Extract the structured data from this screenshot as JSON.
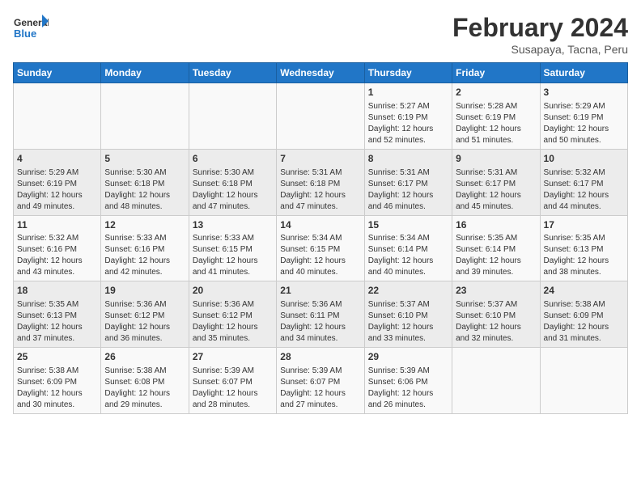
{
  "header": {
    "logo_line1": "General",
    "logo_line2": "Blue",
    "month_title": "February 2024",
    "subtitle": "Susapaya, Tacna, Peru"
  },
  "days_of_week": [
    "Sunday",
    "Monday",
    "Tuesday",
    "Wednesday",
    "Thursday",
    "Friday",
    "Saturday"
  ],
  "weeks": [
    [
      {
        "day": "",
        "info": ""
      },
      {
        "day": "",
        "info": ""
      },
      {
        "day": "",
        "info": ""
      },
      {
        "day": "",
        "info": ""
      },
      {
        "day": "1",
        "info": "Sunrise: 5:27 AM\nSunset: 6:19 PM\nDaylight: 12 hours\nand 52 minutes."
      },
      {
        "day": "2",
        "info": "Sunrise: 5:28 AM\nSunset: 6:19 PM\nDaylight: 12 hours\nand 51 minutes."
      },
      {
        "day": "3",
        "info": "Sunrise: 5:29 AM\nSunset: 6:19 PM\nDaylight: 12 hours\nand 50 minutes."
      }
    ],
    [
      {
        "day": "4",
        "info": "Sunrise: 5:29 AM\nSunset: 6:19 PM\nDaylight: 12 hours\nand 49 minutes."
      },
      {
        "day": "5",
        "info": "Sunrise: 5:30 AM\nSunset: 6:18 PM\nDaylight: 12 hours\nand 48 minutes."
      },
      {
        "day": "6",
        "info": "Sunrise: 5:30 AM\nSunset: 6:18 PM\nDaylight: 12 hours\nand 47 minutes."
      },
      {
        "day": "7",
        "info": "Sunrise: 5:31 AM\nSunset: 6:18 PM\nDaylight: 12 hours\nand 47 minutes."
      },
      {
        "day": "8",
        "info": "Sunrise: 5:31 AM\nSunset: 6:17 PM\nDaylight: 12 hours\nand 46 minutes."
      },
      {
        "day": "9",
        "info": "Sunrise: 5:31 AM\nSunset: 6:17 PM\nDaylight: 12 hours\nand 45 minutes."
      },
      {
        "day": "10",
        "info": "Sunrise: 5:32 AM\nSunset: 6:17 PM\nDaylight: 12 hours\nand 44 minutes."
      }
    ],
    [
      {
        "day": "11",
        "info": "Sunrise: 5:32 AM\nSunset: 6:16 PM\nDaylight: 12 hours\nand 43 minutes."
      },
      {
        "day": "12",
        "info": "Sunrise: 5:33 AM\nSunset: 6:16 PM\nDaylight: 12 hours\nand 42 minutes."
      },
      {
        "day": "13",
        "info": "Sunrise: 5:33 AM\nSunset: 6:15 PM\nDaylight: 12 hours\nand 41 minutes."
      },
      {
        "day": "14",
        "info": "Sunrise: 5:34 AM\nSunset: 6:15 PM\nDaylight: 12 hours\nand 40 minutes."
      },
      {
        "day": "15",
        "info": "Sunrise: 5:34 AM\nSunset: 6:14 PM\nDaylight: 12 hours\nand 40 minutes."
      },
      {
        "day": "16",
        "info": "Sunrise: 5:35 AM\nSunset: 6:14 PM\nDaylight: 12 hours\nand 39 minutes."
      },
      {
        "day": "17",
        "info": "Sunrise: 5:35 AM\nSunset: 6:13 PM\nDaylight: 12 hours\nand 38 minutes."
      }
    ],
    [
      {
        "day": "18",
        "info": "Sunrise: 5:35 AM\nSunset: 6:13 PM\nDaylight: 12 hours\nand 37 minutes."
      },
      {
        "day": "19",
        "info": "Sunrise: 5:36 AM\nSunset: 6:12 PM\nDaylight: 12 hours\nand 36 minutes."
      },
      {
        "day": "20",
        "info": "Sunrise: 5:36 AM\nSunset: 6:12 PM\nDaylight: 12 hours\nand 35 minutes."
      },
      {
        "day": "21",
        "info": "Sunrise: 5:36 AM\nSunset: 6:11 PM\nDaylight: 12 hours\nand 34 minutes."
      },
      {
        "day": "22",
        "info": "Sunrise: 5:37 AM\nSunset: 6:10 PM\nDaylight: 12 hours\nand 33 minutes."
      },
      {
        "day": "23",
        "info": "Sunrise: 5:37 AM\nSunset: 6:10 PM\nDaylight: 12 hours\nand 32 minutes."
      },
      {
        "day": "24",
        "info": "Sunrise: 5:38 AM\nSunset: 6:09 PM\nDaylight: 12 hours\nand 31 minutes."
      }
    ],
    [
      {
        "day": "25",
        "info": "Sunrise: 5:38 AM\nSunset: 6:09 PM\nDaylight: 12 hours\nand 30 minutes."
      },
      {
        "day": "26",
        "info": "Sunrise: 5:38 AM\nSunset: 6:08 PM\nDaylight: 12 hours\nand 29 minutes."
      },
      {
        "day": "27",
        "info": "Sunrise: 5:39 AM\nSunset: 6:07 PM\nDaylight: 12 hours\nand 28 minutes."
      },
      {
        "day": "28",
        "info": "Sunrise: 5:39 AM\nSunset: 6:07 PM\nDaylight: 12 hours\nand 27 minutes."
      },
      {
        "day": "29",
        "info": "Sunrise: 5:39 AM\nSunset: 6:06 PM\nDaylight: 12 hours\nand 26 minutes."
      },
      {
        "day": "",
        "info": ""
      },
      {
        "day": "",
        "info": ""
      }
    ]
  ]
}
